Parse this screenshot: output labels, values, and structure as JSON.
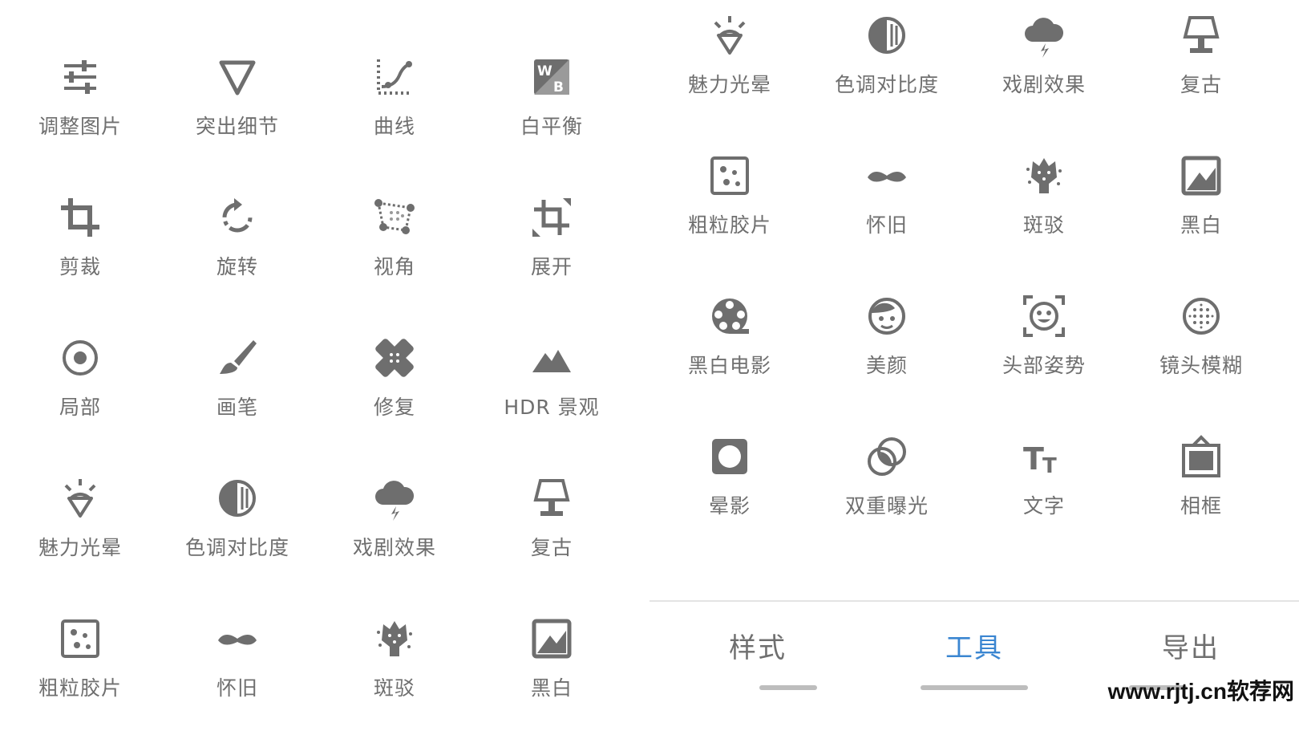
{
  "left_tools": [
    {
      "label": "调整图片",
      "icon": "tune-icon"
    },
    {
      "label": "突出细节",
      "icon": "details-icon"
    },
    {
      "label": "曲线",
      "icon": "curves-icon"
    },
    {
      "label": "白平衡",
      "icon": "white-balance-icon"
    },
    {
      "label": "剪裁",
      "icon": "crop-icon"
    },
    {
      "label": "旋转",
      "icon": "rotate-icon"
    },
    {
      "label": "视角",
      "icon": "perspective-icon"
    },
    {
      "label": "展开",
      "icon": "expand-icon"
    },
    {
      "label": "局部",
      "icon": "selective-icon"
    },
    {
      "label": "画笔",
      "icon": "brush-icon"
    },
    {
      "label": "修复",
      "icon": "healing-icon"
    },
    {
      "label": "HDR 景观",
      "icon": "hdr-mountain-icon"
    },
    {
      "label": "魅力光晕",
      "icon": "glamour-glow-icon"
    },
    {
      "label": "色调对比度",
      "icon": "tonal-contrast-icon"
    },
    {
      "label": "戏剧效果",
      "icon": "drama-cloud-icon"
    },
    {
      "label": "复古",
      "icon": "vintage-lamp-icon"
    },
    {
      "label": "粗粒胶片",
      "icon": "grainy-film-icon"
    },
    {
      "label": "怀旧",
      "icon": "retrolux-mustache-icon"
    },
    {
      "label": "斑驳",
      "icon": "grunge-icon"
    },
    {
      "label": "黑白",
      "icon": "black-white-icon"
    }
  ],
  "right_tools": [
    {
      "label": "魅力光晕",
      "icon": "glamour-glow-icon"
    },
    {
      "label": "色调对比度",
      "icon": "tonal-contrast-icon"
    },
    {
      "label": "戏剧效果",
      "icon": "drama-cloud-icon"
    },
    {
      "label": "复古",
      "icon": "vintage-lamp-icon"
    },
    {
      "label": "粗粒胶片",
      "icon": "grainy-film-icon"
    },
    {
      "label": "怀旧",
      "icon": "retrolux-mustache-icon"
    },
    {
      "label": "斑驳",
      "icon": "grunge-icon"
    },
    {
      "label": "黑白",
      "icon": "black-white-icon"
    },
    {
      "label": "黑白电影",
      "icon": "noir-film-reel-icon"
    },
    {
      "label": "美颜",
      "icon": "face-icon"
    },
    {
      "label": "头部姿势",
      "icon": "head-pose-icon"
    },
    {
      "label": "镜头模糊",
      "icon": "lens-blur-icon"
    },
    {
      "label": "晕影",
      "icon": "vignette-icon"
    },
    {
      "label": "双重曝光",
      "icon": "double-exposure-icon"
    },
    {
      "label": "文字",
      "icon": "text-icon"
    },
    {
      "label": "相框",
      "icon": "frame-icon"
    }
  ],
  "tabs": {
    "styles": "样式",
    "tools": "工具",
    "export": "导出"
  },
  "watermark": "www.rjtj.cn软荐网",
  "colors": {
    "icon": "#6e6e6e",
    "active_tab": "#3b86d1",
    "tab_indicator": "#bdbdbd"
  }
}
